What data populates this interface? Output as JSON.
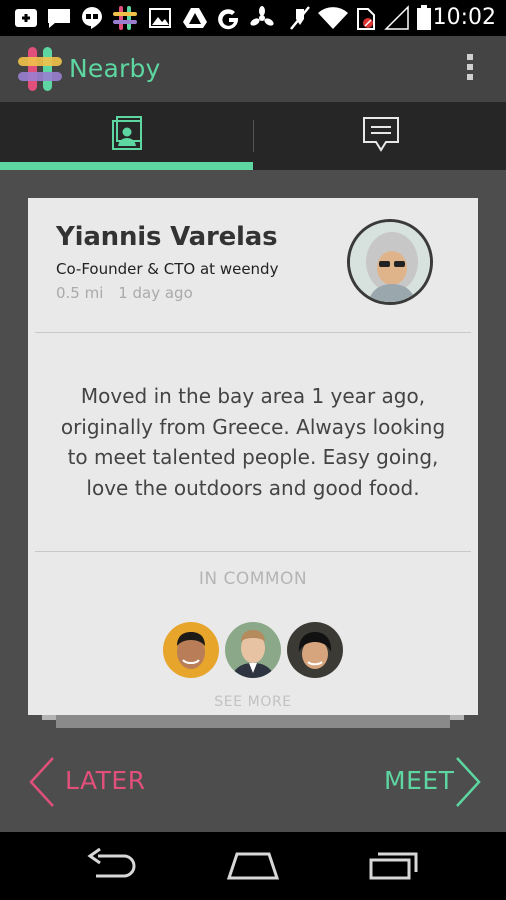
{
  "status_bar": {
    "time": "10:02",
    "icons": [
      "blackberry-messenger-icon",
      "chat-icon",
      "hangouts-icon",
      "nearby-app-icon",
      "gallery-icon",
      "drive-icon",
      "google-icon",
      "fan-icon",
      "mute-icon",
      "wifi-icon",
      "no-sim-icon",
      "signal-icon",
      "battery-icon"
    ]
  },
  "action_bar": {
    "title": "Nearby",
    "menu_icon": "overflow-menu-icon"
  },
  "tabs": [
    {
      "name": "profile",
      "icon": "profile-card-icon",
      "selected": true
    },
    {
      "name": "messages",
      "icon": "chat-bubble-icon",
      "selected": false
    }
  ],
  "profile": {
    "name": "Yiannis Varelas",
    "role": "Co-Founder & CTO at weendy",
    "distance": "0.5 mi",
    "last_seen": "1 day ago",
    "bio": "Moved in the bay area 1 year ago, originally from Greece. Always looking to meet talented people. Easy going, love the outdoors and good food."
  },
  "in_common": {
    "label": "IN COMMON",
    "see_more": "SEE MORE",
    "avatars": [
      "person-1-avatar",
      "person-2-avatar",
      "person-3-avatar"
    ]
  },
  "actions": {
    "later": "LATER",
    "meet": "MEET"
  },
  "colors": {
    "accent": "#5dd6a1",
    "later": "#e0507a",
    "card": "#e9e9e9",
    "background": "#4d4d4d"
  }
}
